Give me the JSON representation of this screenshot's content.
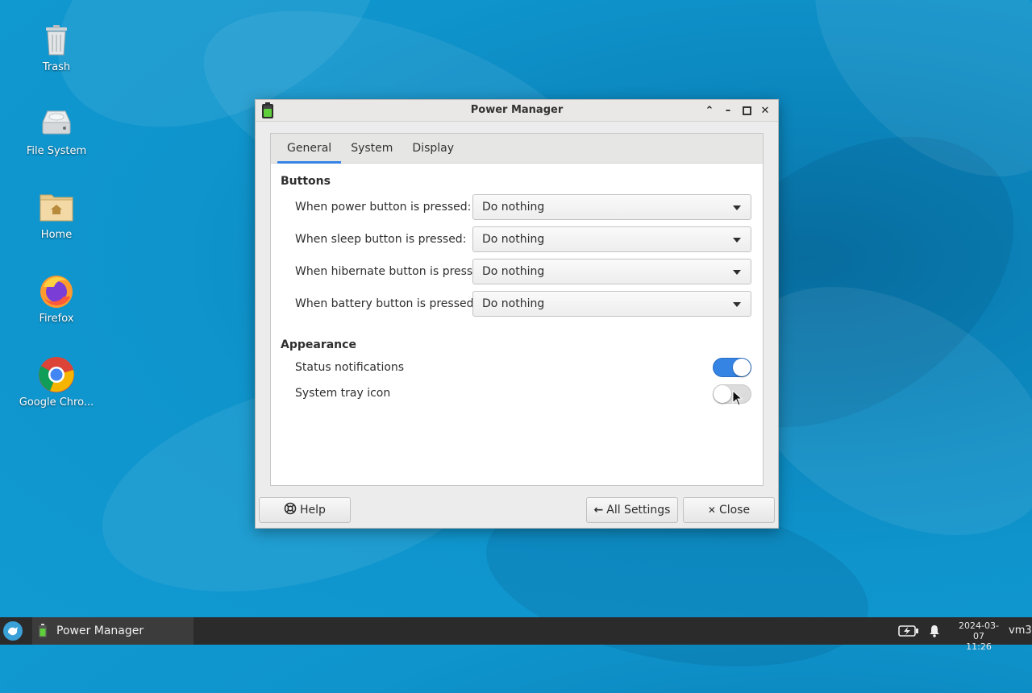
{
  "desktop": {
    "icons": [
      {
        "label": "Trash",
        "icon": "trash-icon"
      },
      {
        "label": "File System",
        "icon": "drive-icon"
      },
      {
        "label": "Home",
        "icon": "home-folder-icon"
      },
      {
        "label": "Firefox",
        "icon": "firefox-icon"
      },
      {
        "label": "Google Chro...",
        "icon": "chrome-icon"
      }
    ]
  },
  "window": {
    "title": "Power Manager",
    "tabs": [
      {
        "label": "General",
        "active": true
      },
      {
        "label": "System",
        "active": false
      },
      {
        "label": "Display",
        "active": false
      }
    ],
    "buttons_section": {
      "title": "Buttons",
      "rows": [
        {
          "label": "When power button is pressed:",
          "value": "Do nothing"
        },
        {
          "label": "When sleep button is pressed:",
          "value": "Do nothing"
        },
        {
          "label": "When hibernate button is pressed:",
          "value": "Do nothing"
        },
        {
          "label": "When battery button is pressed:",
          "value": "Do nothing"
        }
      ]
    },
    "appearance_section": {
      "title": "Appearance",
      "toggles": [
        {
          "label": "Status notifications",
          "on": true
        },
        {
          "label": "System tray icon",
          "on": false
        }
      ]
    },
    "footer": {
      "help": "Help",
      "all_settings": "All Settings",
      "close": "Close"
    }
  },
  "taskbar": {
    "task_label": "Power Manager",
    "date": "2024-03-07",
    "time": "11:26",
    "host": "vm3"
  },
  "colors": {
    "accent": "#3584e4",
    "desktop": "#0f94cc",
    "taskbar": "#2b2b2b"
  }
}
